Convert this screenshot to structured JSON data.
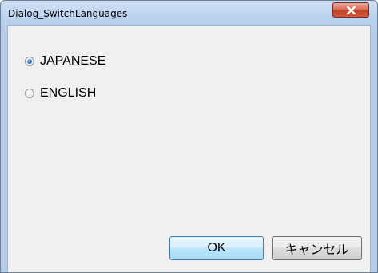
{
  "window": {
    "title": "Dialog_SwitchLanguages"
  },
  "options": [
    {
      "label": "JAPANESE",
      "checked": true
    },
    {
      "label": "ENGLISH",
      "checked": false
    }
  ],
  "buttons": {
    "ok_label": "OK",
    "cancel_label": "キャンセル"
  },
  "icons": {
    "close": "close-icon"
  },
  "colors": {
    "titlebar": "#bcd3ee",
    "client_bg": "#f0f0f0",
    "close_button": "#c2412b",
    "default_button_border": "#3c7fb1"
  }
}
